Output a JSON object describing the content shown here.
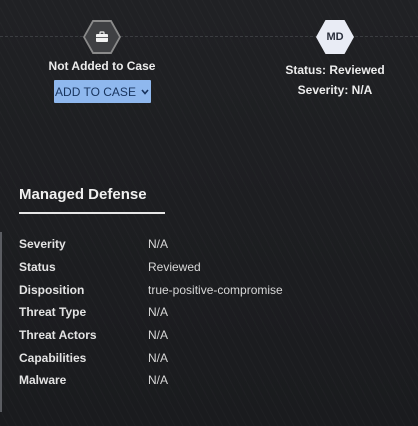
{
  "case": {
    "label": "Not Added to Case",
    "button_label": "ADD TO CASE",
    "icon": "briefcase-icon"
  },
  "md": {
    "badge": "MD",
    "status": "Status: Reviewed",
    "severity": "Severity: N/A"
  },
  "section": {
    "title": "Managed Defense",
    "rows": [
      {
        "key": "Severity",
        "value": "N/A"
      },
      {
        "key": "Status",
        "value": "Reviewed"
      },
      {
        "key": "Disposition",
        "value": "true-positive-compromise"
      },
      {
        "key": "Threat Type",
        "value": "N/A"
      },
      {
        "key": "Threat Actors",
        "value": "N/A"
      },
      {
        "key": "Capabilities",
        "value": "N/A"
      },
      {
        "key": "Malware",
        "value": "N/A"
      }
    ]
  },
  "colors": {
    "button_bg": "#8fb8ee",
    "button_text": "#18345e",
    "background": "#1b1c1f"
  }
}
